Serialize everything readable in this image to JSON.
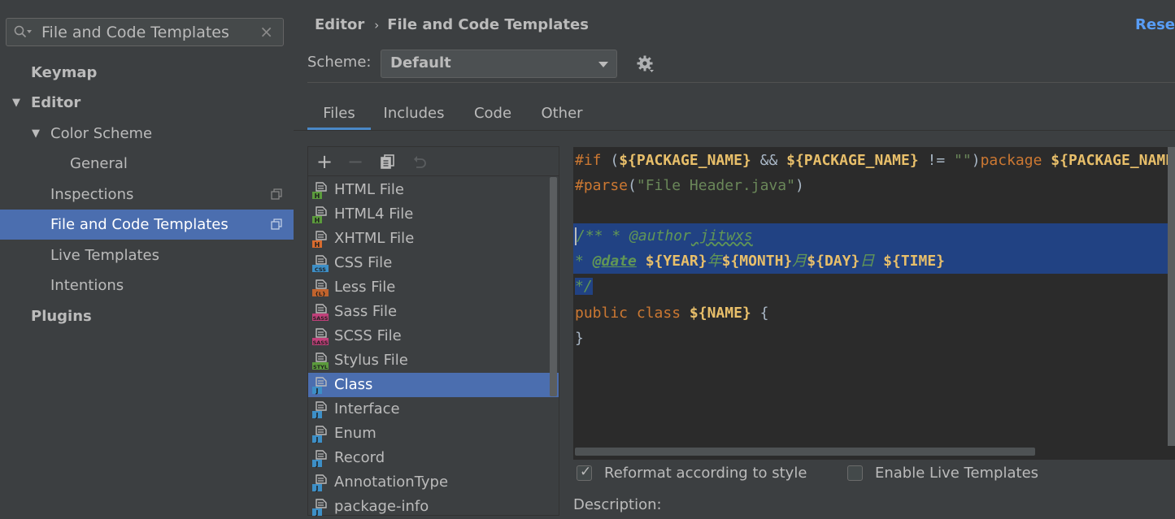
{
  "search": {
    "value": "File and Code Templates"
  },
  "sidebar": {
    "items": [
      {
        "label": "Keymap"
      },
      {
        "label": "Editor"
      },
      {
        "label": "Color Scheme"
      },
      {
        "label": "General"
      },
      {
        "label": "Inspections"
      },
      {
        "label": "File and Code Templates"
      },
      {
        "label": "Live Templates"
      },
      {
        "label": "Intentions"
      },
      {
        "label": "Plugins"
      }
    ]
  },
  "header": {
    "breadcrumb_parent": "Editor",
    "breadcrumb_sep": "›",
    "breadcrumb_current": "File and Code Templates",
    "reset_label": "Rese"
  },
  "scheme": {
    "label": "Scheme:",
    "value": "Default"
  },
  "tabs": [
    {
      "label": "Files"
    },
    {
      "label": "Includes"
    },
    {
      "label": "Code"
    },
    {
      "label": "Other"
    }
  ],
  "toolbar": {
    "add": "+",
    "remove": "−"
  },
  "files": [
    {
      "name": "HTML File",
      "icon": "H",
      "color": "#5b9b3c"
    },
    {
      "name": "HTML4 File",
      "icon": "H",
      "color": "#5b9b3c"
    },
    {
      "name": "XHTML File",
      "icon": "H",
      "color": "#d86b2e"
    },
    {
      "name": "CSS File",
      "icon": "CSS",
      "color": "#3d8fc7"
    },
    {
      "name": "Less File",
      "icon": "{L}",
      "color": "#c0632d"
    },
    {
      "name": "Sass File",
      "icon": "SASS",
      "color": "#c0407a"
    },
    {
      "name": "SCSS File",
      "icon": "SASS",
      "color": "#c0407a"
    },
    {
      "name": "Stylus File",
      "icon": "STYL",
      "color": "#5b9b3c"
    },
    {
      "name": "Class",
      "icon": "J",
      "color": "#3d8fc7"
    },
    {
      "name": "Interface",
      "icon": "J",
      "color": "#3d8fc7"
    },
    {
      "name": "Enum",
      "icon": "J",
      "color": "#3d8fc7"
    },
    {
      "name": "Record",
      "icon": "J",
      "color": "#3d8fc7"
    },
    {
      "name": "AnnotationType",
      "icon": "J",
      "color": "#3d8fc7"
    },
    {
      "name": "package-info",
      "icon": "J",
      "color": "#3d8fc7"
    }
  ],
  "code": {
    "l1_if": "#if",
    "l1_open": " (",
    "l1_pkg1": "${PACKAGE_NAME}",
    "l1_and": " && ",
    "l1_pkg2": "${PACKAGE_NAME}",
    "l1_ne": " != ",
    "l1_str": "\"\"",
    "l1_close": ")",
    "l1_package": "package ",
    "l1_pkg3": "${PACKAGE_NAME};#end",
    "l2_parse": "#parse",
    "l2_open": "(",
    "l2_str": "\"File Header.java\"",
    "l2_close": ")",
    "l4_cmt": "/** * ",
    "l4_tag": "@author",
    "l4_name": " jitwxs",
    "l5_star": "* ",
    "l5_tag": "@date",
    "l5_sp": " ",
    "l5_year": "${YEAR}",
    "l5_nian": "年",
    "l5_month": "${MONTH}",
    "l5_yue": "月",
    "l5_day": "${DAY}",
    "l5_ri": "日 ",
    "l5_time": "${TIME}",
    "l6_end": "*/",
    "l7_public": "public ",
    "l7_class": "class ",
    "l7_name": "${NAME}",
    "l7_brace": " {",
    "l8_brace": "}"
  },
  "options": {
    "reformat_label": "Reformat according to style",
    "reformat_checked": true,
    "live_label": "Enable Live Templates",
    "live_checked": false
  },
  "description_label": "Description:"
}
